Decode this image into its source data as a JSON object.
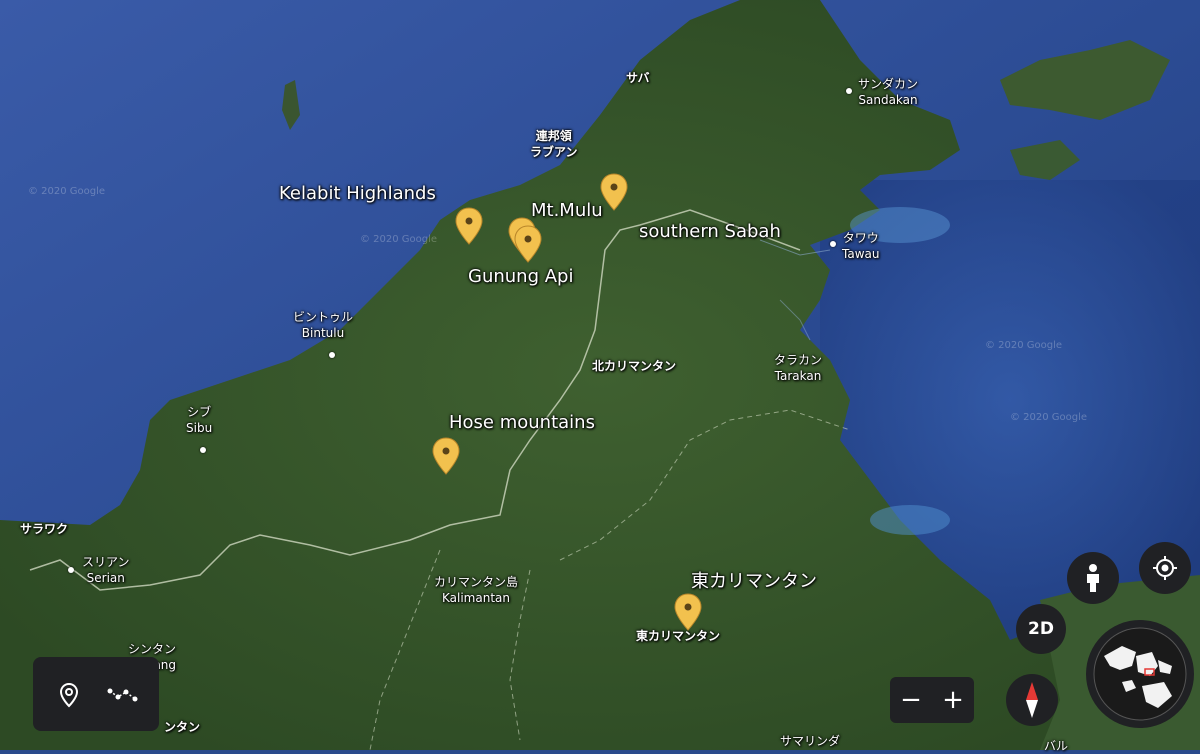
{
  "labels": {
    "sabah_jp": "サバ",
    "labuan_jp_1": "連邦領",
    "labuan_jp_2": "ラブアン",
    "sandakan_jp": "サンダカン",
    "sandakan": "Sandakan",
    "tawau_jp": "タワウ",
    "tawau": "Tawau",
    "bintulu_jp": "ビントゥル",
    "bintulu": "Bintulu",
    "north_kalimantan_jp": "北カリマンタン",
    "tarakan_jp": "タラカン",
    "tarakan": "Tarakan",
    "sibu_jp": "シブ",
    "sibu": "Sibu",
    "sarawak_jp": "サラワク",
    "serian_jp": "スリアン",
    "serian": "Serian",
    "kalimantan_jp": "カリマンタン島",
    "kalimantan": "Kalimantan",
    "east_kalimantan_small_jp": "東カリマンタン",
    "sintang_jp": "シンタン",
    "sintang_partial": "ang",
    "central_kalimantan_partial": "ンタン",
    "samarinda_partial": "サマリンダ",
    "balikpapan_partial": "バル"
  },
  "places": {
    "kelabit": "Kelabit Highlands",
    "mulu": "Mt.Mulu",
    "southern_sabah": "southern Sabah",
    "gunung_api": "Gunung Api",
    "hose": "Hose mountains",
    "east_kalimantan": "東カリマンタン"
  },
  "watermark": "© 2020 Google",
  "controls": {
    "mode_2d": "2D",
    "zoom_out": "−",
    "zoom_in": "+"
  },
  "icons": {
    "pin": "map-pin-icon",
    "path": "path-tool-icon",
    "person": "pegman-icon",
    "locate": "my-location-icon",
    "compass": "compass-icon",
    "globe": "globe-icon"
  },
  "colors": {
    "pin": "#f2c14e",
    "ocean": "#2b4d92",
    "land": "#3e5e2e"
  }
}
